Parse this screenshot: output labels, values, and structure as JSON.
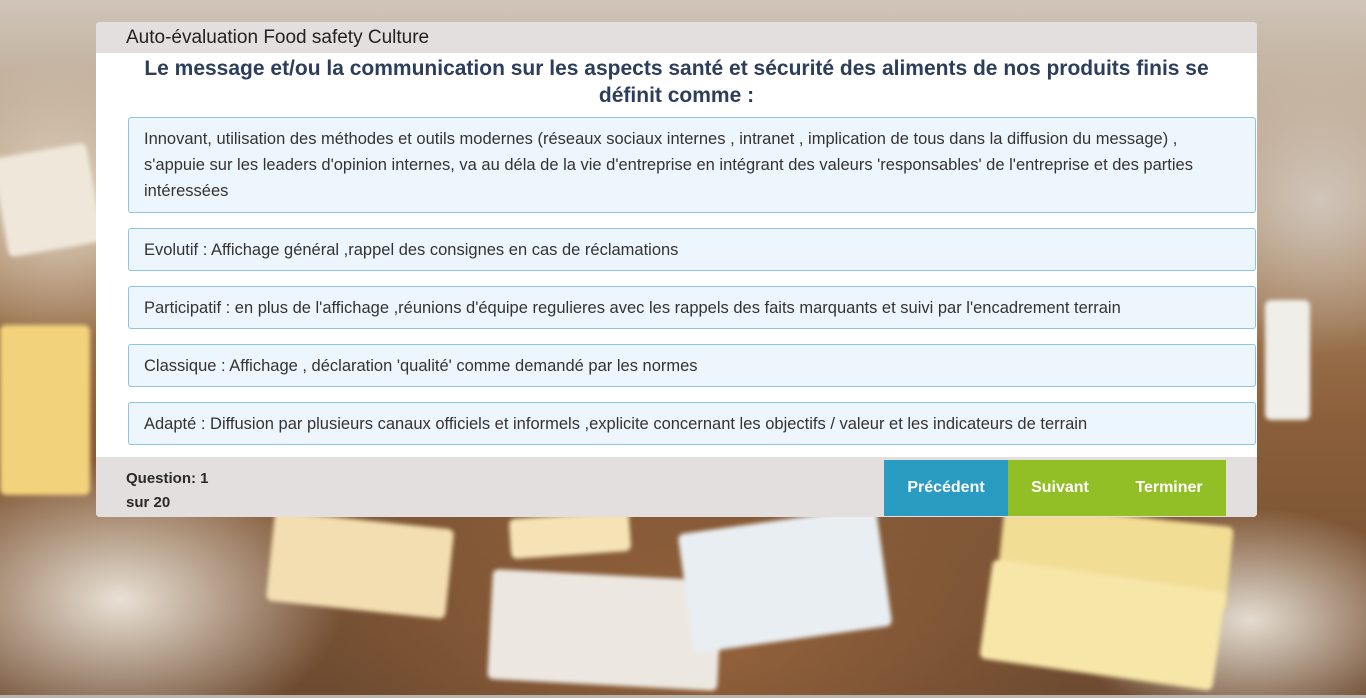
{
  "header": {
    "title": "Auto-évaluation Food safety Culture"
  },
  "question": {
    "text": "Le message et/ou la communication sur les aspects santé et sécurité des aliments de nos produits finis se définit comme :"
  },
  "answers": [
    {
      "label": "Innovant, utilisation des méthodes et outils modernes (réseaux sociaux internes , intranet , implication de tous dans la diffusion du message) , s'appuie sur les leaders d'opinion internes, va au déla de la vie d'entreprise en intégrant des valeurs 'responsables' de l'entreprise et des parties intéressées"
    },
    {
      "label": "Evolutif : Affichage général ,rappel des consignes en cas de réclamations"
    },
    {
      "label": "Participatif : en plus de l'affichage ,réunions d'équipe regulieres avec les rappels des faits marquants et suivi par l'encadrement terrain"
    },
    {
      "label": "Classique : Affichage , déclaration 'qualité' comme demandé par les normes"
    },
    {
      "label": "Adapté : Diffusion par plusieurs canaux officiels et informels ,explicite concernant les objectifs / valeur et les indicateurs de terrain"
    }
  ],
  "footer": {
    "question_label": "Question: 1",
    "total_label": "sur 20",
    "prev_label": "Précédent",
    "next_label": "Suivant",
    "finish_label": "Terminer"
  },
  "colors": {
    "prev_button": "#2a9bc1",
    "next_button": "#93bf26",
    "answer_bg": "#eef6fd",
    "answer_border": "#8fc4e6",
    "question_text": "#2c3e5a"
  }
}
